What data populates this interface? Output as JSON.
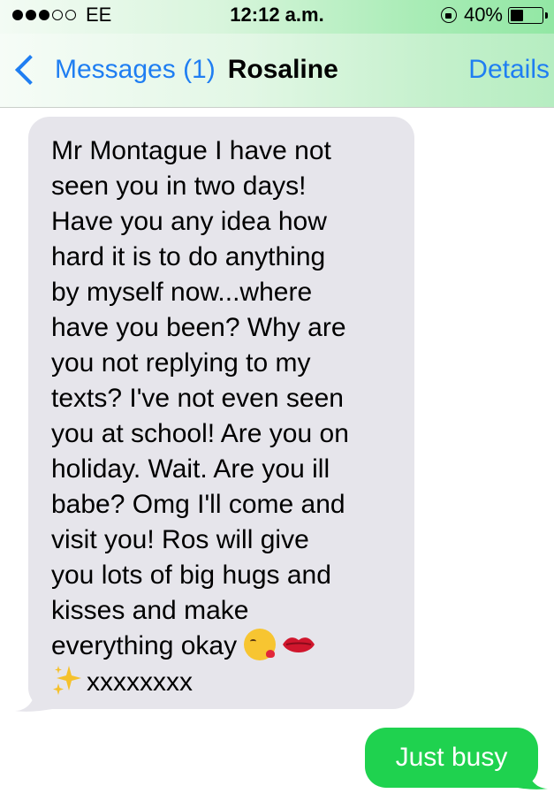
{
  "status_bar": {
    "signal_filled_dots": 3,
    "signal_empty_dots": 2,
    "carrier": "EE",
    "time": "12:12 a.m.",
    "battery_percent": "40%",
    "battery_level": 0.4,
    "icons": [
      "signal-dots-icon",
      "orientation-lock-icon",
      "battery-icon"
    ]
  },
  "nav": {
    "back_label": "Messages (1)",
    "contact_name": "Rosaline",
    "details_label": "Details",
    "accent_color": "#1f7ef2"
  },
  "messages": [
    {
      "direction": "incoming",
      "bubble_color": "#e6e5eb",
      "lines": [
        "Mr Montague I have not",
        "seen you in two days!",
        "Have you any idea how",
        "hard it is to do anything",
        "by myself now...where",
        "have you been? Why are",
        "you not replying to my",
        "texts? I've not even seen",
        "you at school! Are you on",
        "holiday. Wait. Are you ill",
        "babe? Omg I'll come and",
        "visit you! Ros will give",
        "you lots of big hugs and",
        "kisses and make",
        "everything okay"
      ],
      "last_line": "xxxxxxxx",
      "emojis": [
        "face-blowing-kiss-icon",
        "kiss-lips-icon",
        "sparkles-icon"
      ]
    },
    {
      "direction": "outgoing",
      "bubble_color": "#1fd24f",
      "text": "Just busy"
    }
  ]
}
